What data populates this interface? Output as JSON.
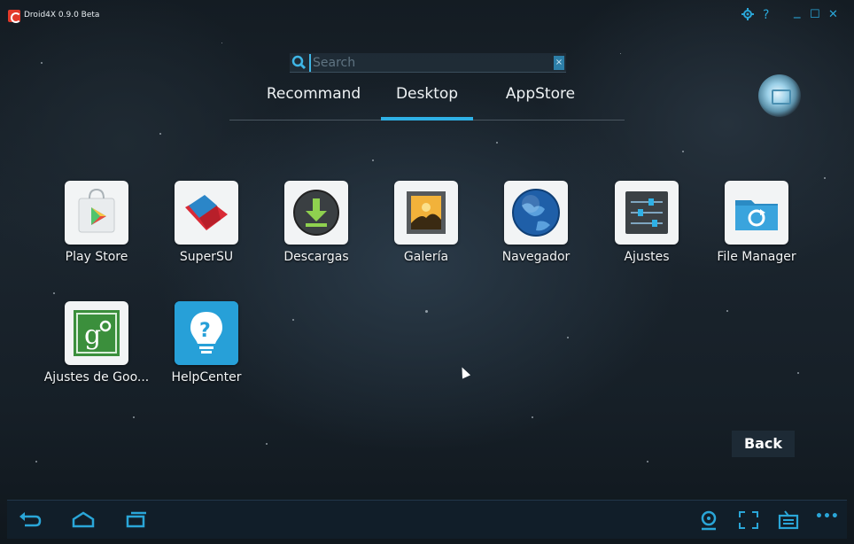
{
  "window": {
    "title": "Droid4X 0.9.0 Beta",
    "controls": [
      "gear-icon",
      "help-icon",
      "minimize-icon",
      "maximize-icon",
      "close-icon"
    ],
    "control_glyphs": {
      "help": "?",
      "minimize": "_",
      "maximize": "☐",
      "close": "✕"
    }
  },
  "search": {
    "placeholder": "Search",
    "value": "",
    "clear_glyph": "×"
  },
  "tabs": [
    {
      "label": "Recommand",
      "selected": false
    },
    {
      "label": "Desktop",
      "selected": true
    },
    {
      "label": "AppStore",
      "selected": false
    }
  ],
  "apps": [
    {
      "label": "Play Store",
      "icon": "play-store-icon"
    },
    {
      "label": "SuperSU",
      "icon": "supersu-icon"
    },
    {
      "label": "Descargas",
      "icon": "download-icon"
    },
    {
      "label": "Galería",
      "icon": "gallery-icon"
    },
    {
      "label": "Navegador",
      "icon": "globe-icon"
    },
    {
      "label": "Ajustes",
      "icon": "settings-sliders-icon"
    },
    {
      "label": "File Manager",
      "icon": "folder-icon"
    },
    {
      "label": "Ajustes de Goo...",
      "icon": "google-settings-icon"
    },
    {
      "label": "HelpCenter",
      "icon": "help-center-icon"
    }
  ],
  "back_button": {
    "label": "Back"
  },
  "navbar": {
    "left": [
      "back-arrow-icon",
      "home-icon",
      "recent-apps-icon"
    ],
    "right": [
      "location-icon",
      "fullscreen-icon",
      "keyboard-icon",
      "more-icon"
    ],
    "more_glyph": "•••"
  },
  "colors": {
    "accent": "#2fb1e6",
    "background": "#1b252e",
    "navbar": "#12202c"
  }
}
